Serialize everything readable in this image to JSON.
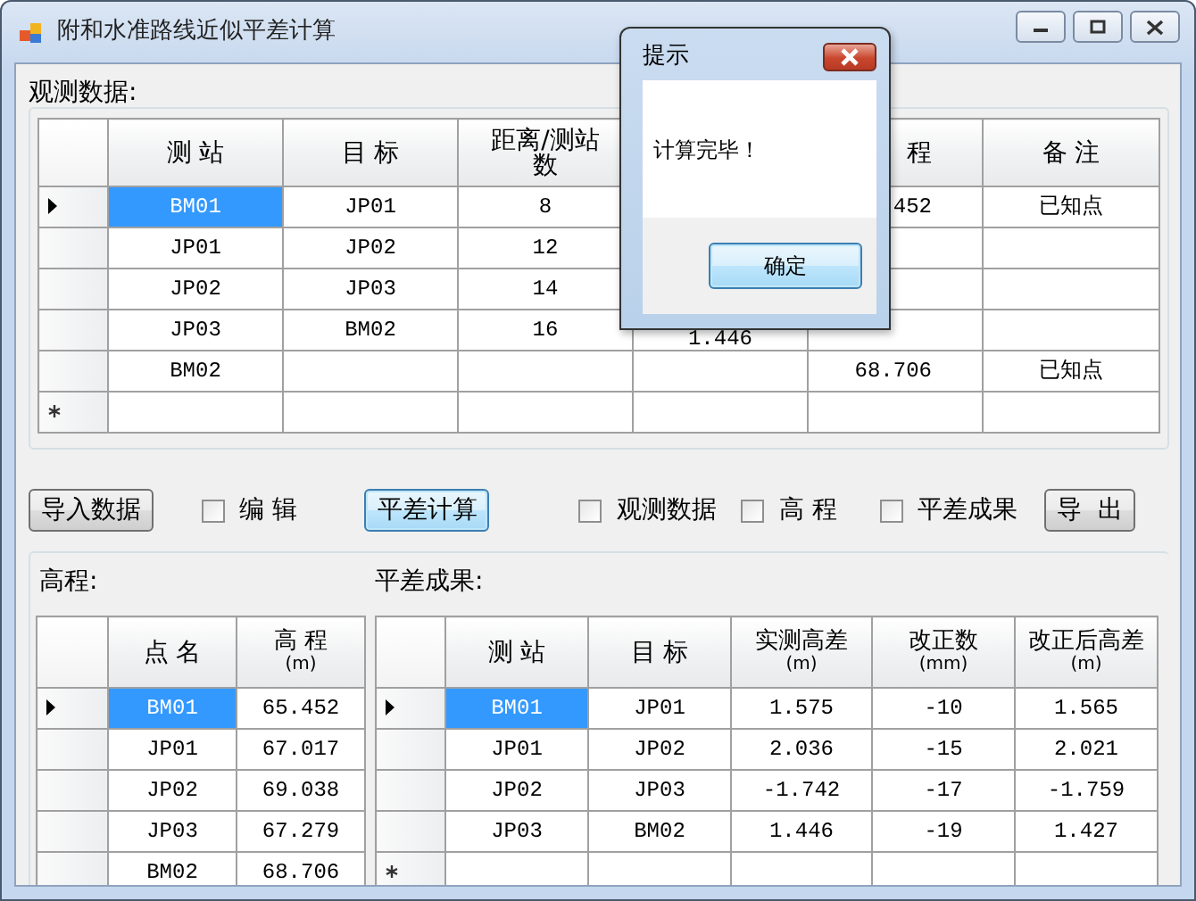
{
  "window": {
    "title": "附和水准路线近似平差计算"
  },
  "observation": {
    "label": "观测数据:",
    "columns": [
      {
        "label": "测 站"
      },
      {
        "label": "目 标"
      },
      {
        "label": "距离/测站数"
      },
      {},
      {
        "label": "程"
      },
      {
        "label": "备 注"
      }
    ],
    "rows": [
      {
        "current": true,
        "new_row": false,
        "selected": true,
        "cells": [
          "BM01",
          "JP01",
          "8",
          null,
          "452",
          "已知点"
        ]
      },
      {
        "current": false,
        "new_row": false,
        "selected": false,
        "cells": [
          "JP01",
          "JP02",
          "12",
          null,
          null,
          null
        ]
      },
      {
        "current": false,
        "new_row": false,
        "selected": false,
        "cells": [
          "JP02",
          "JP03",
          "14",
          null,
          null,
          null
        ]
      },
      {
        "current": false,
        "new_row": false,
        "selected": false,
        "cells": [
          "JP03",
          "BM02",
          "16",
          "1.446",
          null,
          null
        ]
      },
      {
        "current": false,
        "new_row": false,
        "selected": false,
        "cells": [
          "BM02",
          null,
          null,
          null,
          "68.706",
          "已知点"
        ]
      },
      {
        "current": false,
        "new_row": true,
        "selected": false,
        "cells": [
          null,
          null,
          null,
          null,
          null,
          null
        ]
      }
    ]
  },
  "toolbar": [
    {
      "kind": "button",
      "label": "导入数据",
      "focused": false
    },
    {
      "kind": "checkbox",
      "label": "编 辑",
      "checked": false
    },
    {
      "kind": "button",
      "label": "平差计算",
      "focused": true
    },
    {
      "kind": "checkbox",
      "label": "观测数据",
      "checked": false
    },
    {
      "kind": "checkbox",
      "label": "高 程",
      "checked": false
    },
    {
      "kind": "checkbox",
      "label": "平差成果",
      "checked": false
    },
    {
      "kind": "button",
      "label": "导  出",
      "focused": false
    }
  ],
  "elevation": {
    "label": "高程:",
    "columns": [
      {
        "label": "点 名"
      },
      {
        "label": "高 程",
        "unit": "(m)"
      }
    ],
    "rows": [
      {
        "current": true,
        "new_row": false,
        "selected": true,
        "cells": [
          "BM01",
          "65.452"
        ]
      },
      {
        "current": false,
        "new_row": false,
        "selected": false,
        "cells": [
          "JP01",
          "67.017"
        ]
      },
      {
        "current": false,
        "new_row": false,
        "selected": false,
        "cells": [
          "JP02",
          "69.038"
        ]
      },
      {
        "current": false,
        "new_row": false,
        "selected": false,
        "cells": [
          "JP03",
          "67.279"
        ]
      },
      {
        "current": false,
        "new_row": false,
        "selected": false,
        "cells": [
          "BM02",
          "68.706"
        ]
      }
    ]
  },
  "adjustment": {
    "label": "平差成果:",
    "columns": [
      {
        "label": "测 站"
      },
      {
        "label": "目 标"
      },
      {
        "label": "实测高差",
        "unit": "(m)"
      },
      {
        "label": "改正数",
        "unit": "(mm)"
      },
      {
        "label": "改正后高差",
        "unit": "(m)"
      }
    ],
    "rows": [
      {
        "current": true,
        "new_row": false,
        "selected": true,
        "cells": [
          "BM01",
          "JP01",
          "1.575",
          "-10",
          "1.565"
        ]
      },
      {
        "current": false,
        "new_row": false,
        "selected": false,
        "cells": [
          "JP01",
          "JP02",
          "2.036",
          "-15",
          "2.021"
        ]
      },
      {
        "current": false,
        "new_row": false,
        "selected": false,
        "cells": [
          "JP02",
          "JP03",
          "-1.742",
          "-17",
          "-1.759"
        ]
      },
      {
        "current": false,
        "new_row": false,
        "selected": false,
        "cells": [
          "JP03",
          "BM02",
          "1.446",
          "-19",
          "1.427"
        ]
      },
      {
        "current": false,
        "new_row": true,
        "selected": false,
        "cells": [
          null,
          null,
          null,
          null,
          null
        ]
      }
    ]
  },
  "dialog": {
    "title": "提示",
    "message": "计算完毕！",
    "button": "确定"
  }
}
